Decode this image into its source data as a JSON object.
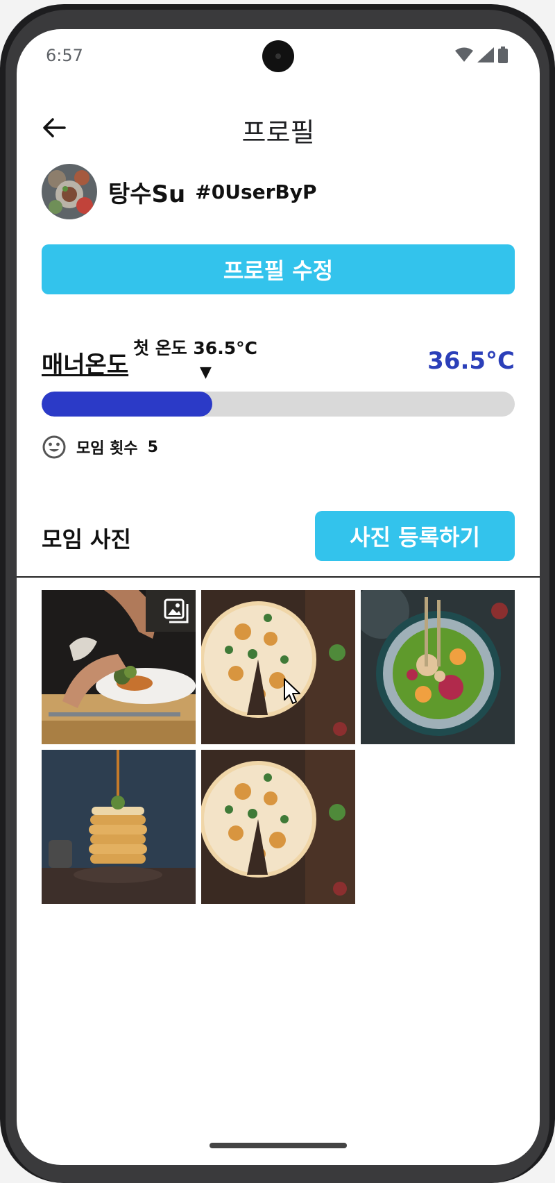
{
  "status_bar": {
    "time": "6:57",
    "icons": [
      "wifi-icon",
      "cellular-icon",
      "battery-icon"
    ]
  },
  "header": {
    "title": "프로필",
    "back_icon": "arrow-left-icon"
  },
  "profile": {
    "name": "탕수Su",
    "tag": "#0UserByP",
    "edit_button": "프로필 수정"
  },
  "manner": {
    "label": "매너온도",
    "first_temp": "첫 온도 36.5°C",
    "value": "36.5°C",
    "progress": 0.36
  },
  "meetings": {
    "label": "모임 횟수",
    "count": "5"
  },
  "photos": {
    "title": "모임 사진",
    "add_button": "사진 등록하기",
    "items": [
      "chef-plating-photo",
      "pizza-photo",
      "salad-bowl-photo",
      "pancake-stack-photo",
      "pizza-photo"
    ]
  },
  "colors": {
    "accent": "#33c3ec",
    "temperature": "#2b3ac7",
    "track": "#d9d9d9"
  }
}
